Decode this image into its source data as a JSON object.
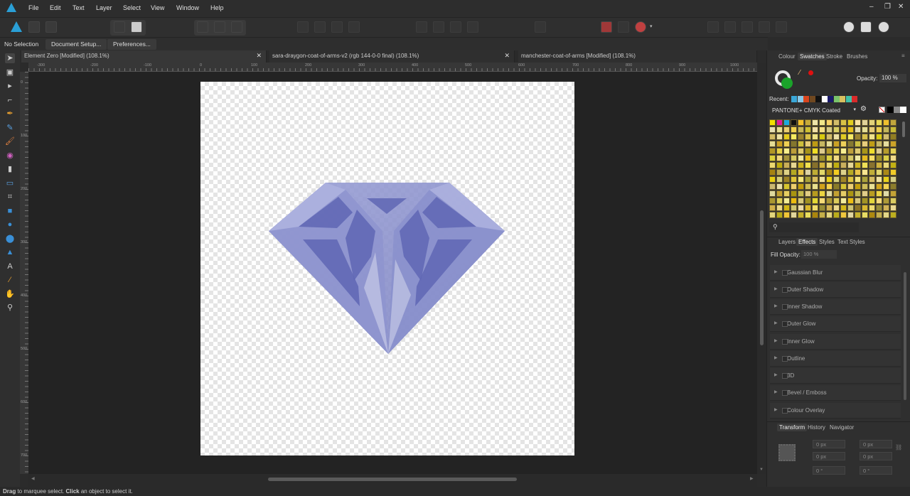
{
  "menubar": {
    "items": [
      "File",
      "Edit",
      "Text",
      "Layer",
      "Select",
      "View",
      "Window",
      "Help"
    ],
    "window_controls": [
      "–",
      "❐",
      "✕"
    ]
  },
  "context": {
    "selection": "No Selection",
    "document_setup": "Document Setup...",
    "preferences": "Preferences..."
  },
  "tabs": [
    {
      "label": "Element Zero [Modified] (108.1%)"
    },
    {
      "label": "sara-draygon-coat-of-arms-v2 (rgb 144-0-0 final) (108.1%)"
    },
    {
      "label": "manchester-coat-of-arms [Modified] (108.1%)"
    }
  ],
  "ruler": {
    "h": [
      "-300",
      "-200",
      "-100",
      "0",
      "100",
      "200",
      "300",
      "400",
      "500",
      "600",
      "700",
      "800",
      "900",
      "1000"
    ],
    "v": [
      "0",
      "100",
      "200",
      "300",
      "400",
      "500",
      "600",
      "700",
      "800"
    ]
  },
  "panel_top": {
    "tabs": [
      "Colour",
      "Swatches",
      "Stroke",
      "Brushes"
    ],
    "active": "Swatches",
    "opacity_label": "Opacity:",
    "opacity_value": "100 %",
    "recent_label": "Recent:",
    "palette": "PANTONE+ CMYK Coated"
  },
  "panel_mid": {
    "tabs": [
      "Layers",
      "Effects",
      "Styles",
      "Text Styles"
    ],
    "active": "Effects",
    "fill_opacity_label": "Fill Opacity:",
    "fill_opacity_value": "100 %",
    "effects": [
      "Gaussian Blur",
      "Outer Shadow",
      "Inner Shadow",
      "Outer Glow",
      "Inner Glow",
      "Outline",
      "3D",
      "Bevel / Emboss",
      "Colour Overlay"
    ]
  },
  "panel_bottom": {
    "tabs": [
      "Transform",
      "History",
      "Navigator"
    ],
    "active": "Transform",
    "fields": [
      "0 px",
      "0 px",
      "0 px",
      "0 px",
      "0 °",
      "0 °"
    ]
  },
  "status": {
    "drag": "Drag",
    "text1": " to marquee select. ",
    "click": "Click",
    "text2": " an object to select it."
  },
  "colors": {
    "accent": "#2a9fd6",
    "diamond": "#8a8fc9",
    "fill_swatch": "#1aa32a",
    "stroke_swatch": "#e01010"
  },
  "recent_colors": [
    "#3aa7d8",
    "#87c8e8",
    "#d8451e",
    "#704820",
    "#111111",
    "#ffffff",
    "#1a1a6a",
    "#7bc46b",
    "#d8c060",
    "#40c0a8",
    "#d82a2a"
  ]
}
